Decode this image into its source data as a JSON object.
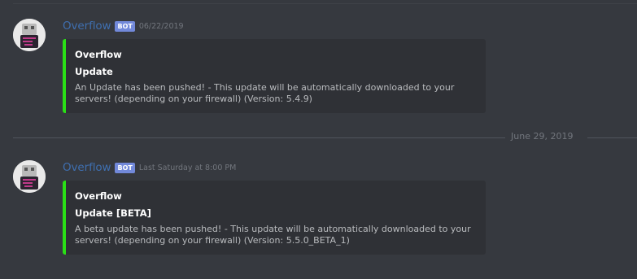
{
  "date_divider": "June 29, 2019",
  "messages": [
    {
      "username": "Overflow",
      "bot_tag": "BOT",
      "timestamp": "06/22/2019",
      "embed": {
        "author": "Overflow",
        "title": "Update",
        "description": "An Update has been pushed! - This update will be automatically downloaded to your servers! (depending on your firewall) (Version: 5.4.9)"
      }
    },
    {
      "username": "Overflow",
      "bot_tag": "BOT",
      "timestamp": "Last Saturday at 8:00 PM",
      "embed": {
        "author": "Overflow",
        "title": "Update [BETA]",
        "description": "A beta update has been pushed! - This update will be automatically downloaded to your servers! (depending on your firewall) (Version: 5.5.0_BETA_1)"
      }
    }
  ],
  "colors": {
    "background": "#36393f",
    "embed_background": "#2f3136",
    "embed_accent": "#2ae016",
    "username": "#3f6fb0",
    "bot_tag": "#7289da",
    "muted_text": "#72767d"
  }
}
